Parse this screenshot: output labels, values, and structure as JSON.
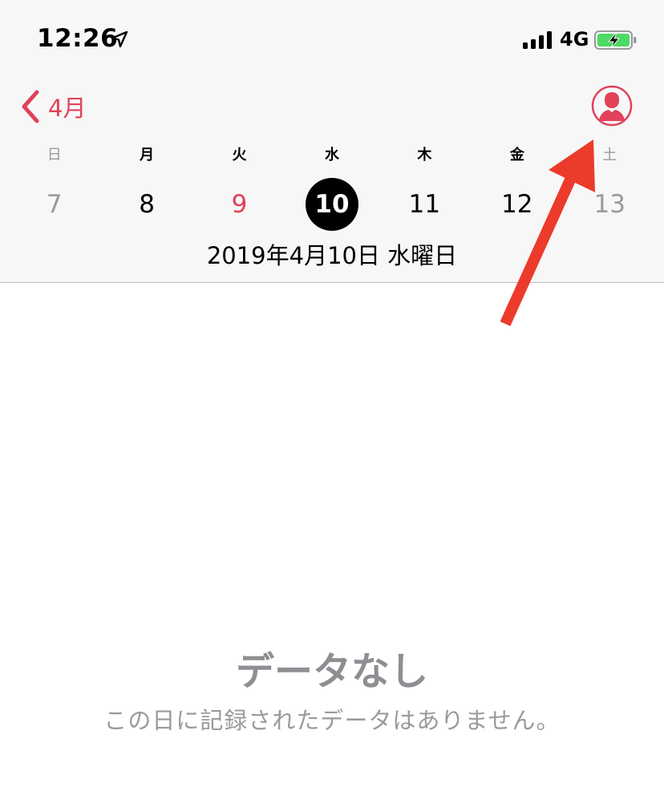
{
  "status_bar": {
    "time": "12:26",
    "network": "4G",
    "icons": [
      "location-arrow-icon",
      "cellular-signal-icon",
      "battery-charging-icon"
    ],
    "battery_color": "#4cd964"
  },
  "header": {
    "back_label": "4月",
    "profile_icon": "user-profile-icon",
    "accent_color": "#e0425a"
  },
  "week": {
    "weekdays": [
      "日",
      "月",
      "火",
      "水",
      "木",
      "金",
      "土"
    ],
    "days": [
      "7",
      "8",
      "9",
      "10",
      "11",
      "12",
      "13"
    ],
    "today": "9",
    "selected": "10"
  },
  "selected_date_label": "2019年4月10日 水曜日",
  "empty_state": {
    "title": "データなし",
    "message": "この日に記録されたデータはありません。"
  },
  "annotation": {
    "type": "arrow",
    "color": "#ec3b2a",
    "points_to": "profile-button"
  }
}
